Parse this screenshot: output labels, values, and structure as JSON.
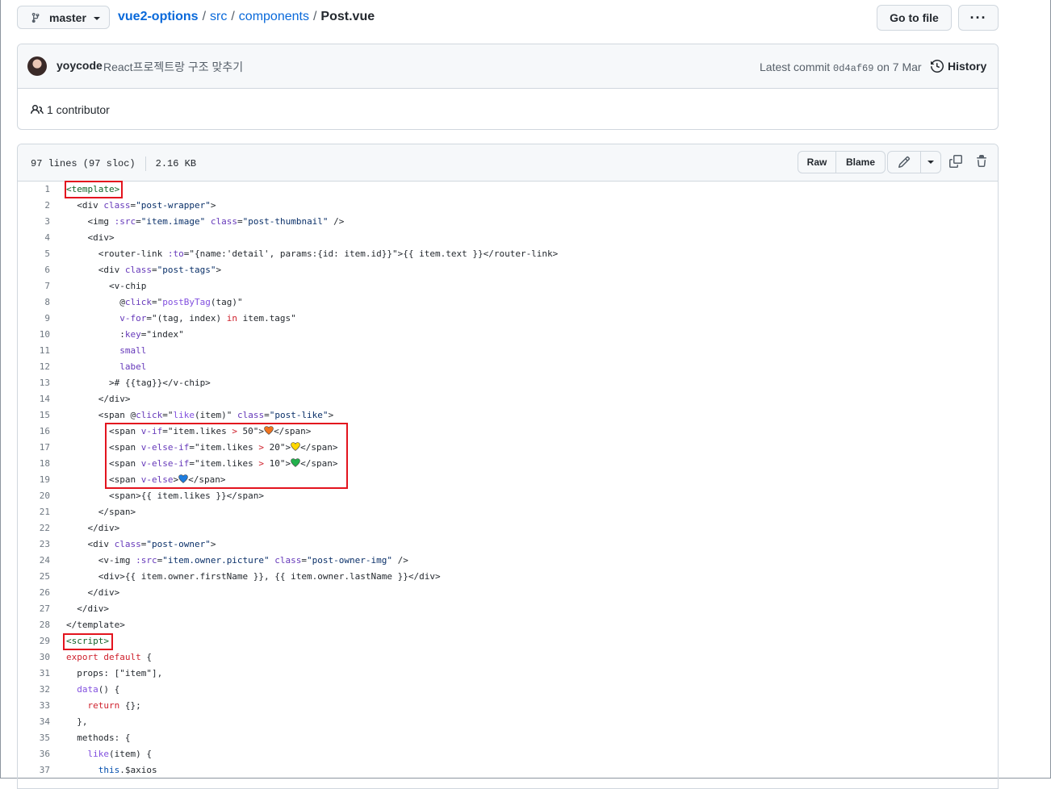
{
  "repo": {
    "branch": "master",
    "name": "vue2-options",
    "path": [
      "src",
      "components"
    ],
    "file": "Post.vue",
    "goto_file": "Go to file",
    "more": "···"
  },
  "commit": {
    "author": "yoycode",
    "message": "React프로젝트랑 구조 맞추기",
    "latest_prefix": "Latest commit",
    "sha": "0d4af69",
    "date": "on 7 Mar",
    "history": "History",
    "contributors": "1 contributor"
  },
  "file": {
    "lines": "97 lines (97 sloc)",
    "size": "2.16 KB",
    "raw": "Raw",
    "blame": "Blame"
  },
  "colors": {
    "highlight_box": "#e3141e",
    "heart_orange": "#f0731e",
    "heart_yellow": "#ffd700",
    "heart_green": "#22b14c",
    "heart_blue": "#1e7de0"
  },
  "code_lines": [
    [
      [
        "t-tag",
        "<template>"
      ]
    ],
    [
      [
        "t-plain",
        "  <div "
      ],
      [
        "t-attr",
        "class"
      ],
      [
        "t-plain",
        "="
      ],
      [
        "t-str",
        "\"post-wrapper\""
      ],
      [
        "t-plain",
        ">"
      ]
    ],
    [
      [
        "t-plain",
        "    <img "
      ],
      [
        "t-attr",
        ":src"
      ],
      [
        "t-plain",
        "="
      ],
      [
        "t-str",
        "\"item.image\""
      ],
      [
        "t-plain",
        " "
      ],
      [
        "t-attr",
        "class"
      ],
      [
        "t-plain",
        "="
      ],
      [
        "t-str",
        "\"post-thumbnail\""
      ],
      [
        "t-plain",
        " />"
      ]
    ],
    [
      [
        "t-plain",
        "    <div>"
      ]
    ],
    [
      [
        "t-plain",
        "      <router-link "
      ],
      [
        "t-attr",
        ":to"
      ],
      [
        "t-plain",
        "=\"{name:'detail', params:{id: item.id}}\">{{ item.text }}</router-link>"
      ]
    ],
    [
      [
        "t-plain",
        "      <div "
      ],
      [
        "t-attr",
        "class"
      ],
      [
        "t-plain",
        "="
      ],
      [
        "t-str",
        "\"post-tags\""
      ],
      [
        "t-plain",
        ">"
      ]
    ],
    [
      [
        "t-plain",
        "        <v-chip"
      ]
    ],
    [
      [
        "t-plain",
        "          @"
      ],
      [
        "t-attr",
        "click"
      ],
      [
        "t-plain",
        "=\""
      ],
      [
        "t-fn",
        "postByTag"
      ],
      [
        "t-plain",
        "(tag)\""
      ]
    ],
    [
      [
        "t-plain",
        "          "
      ],
      [
        "t-attr",
        "v-for"
      ],
      [
        "t-plain",
        "=\"(tag, index) "
      ],
      [
        "t-kw",
        "in"
      ],
      [
        "t-plain",
        " item.tags\""
      ]
    ],
    [
      [
        "t-plain",
        "          :"
      ],
      [
        "t-attr",
        "key"
      ],
      [
        "t-plain",
        "=\"index\""
      ]
    ],
    [
      [
        "t-plain",
        "          "
      ],
      [
        "t-attr",
        "small"
      ]
    ],
    [
      [
        "t-plain",
        "          "
      ],
      [
        "t-attr",
        "label"
      ]
    ],
    [
      [
        "t-plain",
        "        ># {{tag}}</v-chip>"
      ]
    ],
    [
      [
        "t-plain",
        "      </div>"
      ]
    ],
    [
      [
        "t-plain",
        "      <span @"
      ],
      [
        "t-attr",
        "click"
      ],
      [
        "t-plain",
        "=\""
      ],
      [
        "t-fn",
        "like"
      ],
      [
        "t-plain",
        "(item)\" "
      ],
      [
        "t-attr",
        "class"
      ],
      [
        "t-plain",
        "="
      ],
      [
        "t-str",
        "\"post-like\""
      ],
      [
        "t-plain",
        ">"
      ]
    ],
    [
      [
        "t-plain",
        "        <span "
      ],
      [
        "t-attr",
        "v-if"
      ],
      [
        "t-plain",
        "=\"item.likes "
      ],
      [
        "t-kw",
        ">"
      ],
      [
        "t-plain",
        " 50\">"
      ],
      [
        "heart",
        "orange"
      ],
      [
        "t-plain",
        "</span>"
      ]
    ],
    [
      [
        "t-plain",
        "        <span "
      ],
      [
        "t-attr",
        "v-else-if"
      ],
      [
        "t-plain",
        "=\"item.likes "
      ],
      [
        "t-kw",
        ">"
      ],
      [
        "t-plain",
        " 20\">"
      ],
      [
        "heart",
        "yellow"
      ],
      [
        "t-plain",
        "</span>"
      ]
    ],
    [
      [
        "t-plain",
        "        <span "
      ],
      [
        "t-attr",
        "v-else-if"
      ],
      [
        "t-plain",
        "=\"item.likes "
      ],
      [
        "t-kw",
        ">"
      ],
      [
        "t-plain",
        " 10\">"
      ],
      [
        "heart",
        "green"
      ],
      [
        "t-plain",
        "</span>"
      ]
    ],
    [
      [
        "t-plain",
        "        <span "
      ],
      [
        "t-attr",
        "v-else"
      ],
      [
        "t-plain",
        ">"
      ],
      [
        "heart",
        "blue"
      ],
      [
        "t-plain",
        "</span>"
      ]
    ],
    [
      [
        "t-plain",
        "        <span>{{ item.likes }}</span>"
      ]
    ],
    [
      [
        "t-plain",
        "      </span>"
      ]
    ],
    [
      [
        "t-plain",
        "    </div>"
      ]
    ],
    [
      [
        "t-plain",
        "    <div "
      ],
      [
        "t-attr",
        "class"
      ],
      [
        "t-plain",
        "="
      ],
      [
        "t-str",
        "\"post-owner\""
      ],
      [
        "t-plain",
        ">"
      ]
    ],
    [
      [
        "t-plain",
        "      <v-img "
      ],
      [
        "t-attr",
        ":src"
      ],
      [
        "t-plain",
        "="
      ],
      [
        "t-str",
        "\"item.owner.picture\""
      ],
      [
        "t-plain",
        " "
      ],
      [
        "t-attr",
        "class"
      ],
      [
        "t-plain",
        "="
      ],
      [
        "t-str",
        "\"post-owner-img\""
      ],
      [
        "t-plain",
        " />"
      ]
    ],
    [
      [
        "t-plain",
        "      <div>{{ item.owner.firstName }}, {{ item.owner.lastName }}</div>"
      ]
    ],
    [
      [
        "t-plain",
        "    </div>"
      ]
    ],
    [
      [
        "t-plain",
        "  </div>"
      ]
    ],
    [
      [
        "t-plain",
        "</template>"
      ]
    ],
    [
      [
        "t-tag",
        "<script>"
      ]
    ],
    [
      [
        "t-kw",
        "export"
      ],
      [
        "t-plain",
        " "
      ],
      [
        "t-kw",
        "default"
      ],
      [
        "t-plain",
        " {"
      ]
    ],
    [
      [
        "t-plain",
        "  props: [\"item\"],"
      ]
    ],
    [
      [
        "t-plain",
        "  "
      ],
      [
        "t-fn",
        "data"
      ],
      [
        "t-plain",
        "() {"
      ]
    ],
    [
      [
        "t-plain",
        "    "
      ],
      [
        "t-kw",
        "return"
      ],
      [
        "t-plain",
        " {};"
      ]
    ],
    [
      [
        "t-plain",
        "  },"
      ]
    ],
    [
      [
        "t-plain",
        "  methods: {"
      ]
    ],
    [
      [
        "t-plain",
        "    "
      ],
      [
        "t-fn",
        "like"
      ],
      [
        "t-plain",
        "(item) {"
      ]
    ],
    [
      [
        "t-plain",
        "      "
      ],
      [
        "t-ent",
        "this"
      ],
      [
        "t-plain",
        ".$axios"
      ]
    ]
  ]
}
